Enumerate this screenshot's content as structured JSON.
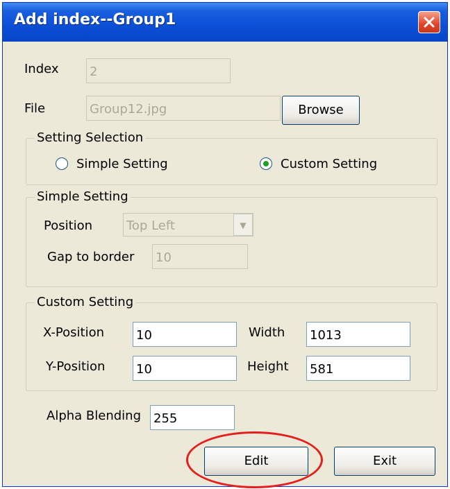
{
  "window": {
    "title": "Add index--Group1",
    "close_icon": "close-icon"
  },
  "index": {
    "label": "Index",
    "value": "2"
  },
  "file": {
    "label": "File",
    "value": "Group12.jpg",
    "browse_label": "Browse"
  },
  "setting_selection": {
    "title": "Setting Selection",
    "options": [
      {
        "label": "Simple Setting",
        "selected": false
      },
      {
        "label": "Custom Setting",
        "selected": true
      }
    ]
  },
  "simple_setting": {
    "title": "Simple Setting",
    "position_label": "Position",
    "position_value": "Top Left",
    "gap_label": "Gap to border",
    "gap_value": "10"
  },
  "custom_setting": {
    "title": "Custom Setting",
    "x_label": "X-Position",
    "x_value": "10",
    "y_label": "Y-Position",
    "y_value": "10",
    "width_label": "Width",
    "width_value": "1013",
    "height_label": "Height",
    "height_value": "581"
  },
  "alpha": {
    "label": "Alpha Blending",
    "value": "255"
  },
  "buttons": {
    "edit": "Edit",
    "exit": "Exit"
  },
  "colors": {
    "titlebar": "#0a4fd6",
    "window_bg": "#ece9d8",
    "highlight": "#e31f1f"
  }
}
